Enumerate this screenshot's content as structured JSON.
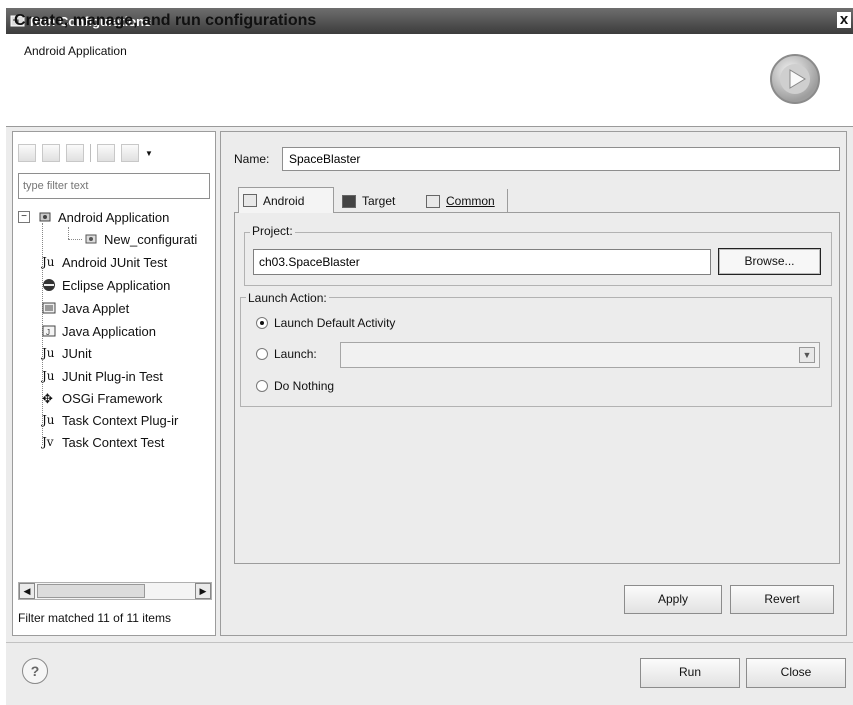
{
  "window": {
    "title": "Run Configurations",
    "close_glyph": "x"
  },
  "header": {
    "title": "Create, manage, and run configurations",
    "subtitle": "Android Application"
  },
  "left": {
    "filter_placeholder": "type filter text",
    "tree": [
      {
        "label": "Android Application",
        "icon": "android-app-icon",
        "expanded": true
      },
      {
        "label": "New_configurati",
        "icon": "android-config-icon"
      },
      {
        "label": "Android JUnit Test",
        "icon": "junit-icon"
      },
      {
        "label": "Eclipse Application",
        "icon": "eclipse-icon"
      },
      {
        "label": "Java Applet",
        "icon": "applet-icon"
      },
      {
        "label": "Java Application",
        "icon": "java-app-icon"
      },
      {
        "label": "JUnit",
        "icon": "junit-icon"
      },
      {
        "label": "JUnit Plug-in Test",
        "icon": "junit-plugin-icon"
      },
      {
        "label": "OSGi Framework",
        "icon": "osgi-icon"
      },
      {
        "label": "Task Context Plug-ir",
        "icon": "task-plugin-icon"
      },
      {
        "label": "Task Context Test",
        "icon": "task-test-icon"
      }
    ],
    "filter_status": "Filter matched 11 of 11 items"
  },
  "right": {
    "name_label": "Name:",
    "name_value": "SpaceBlaster",
    "tabs": [
      {
        "label": "Android",
        "icon": "android-tab-icon",
        "selected": true
      },
      {
        "label": "Target",
        "icon": "target-tab-icon"
      },
      {
        "label": "Common",
        "icon": "common-tab-icon"
      }
    ],
    "project": {
      "group_label": "Project:",
      "value": "ch03.SpaceBlaster",
      "browse_label": "Browse..."
    },
    "launch_action": {
      "group_label": "Launch Action:",
      "options": [
        {
          "label": "Launch Default Activity",
          "checked": true
        },
        {
          "label": "Launch:",
          "checked": false
        },
        {
          "label": "Do Nothing",
          "checked": false
        }
      ],
      "launch_value": ""
    },
    "apply_label": "Apply",
    "revert_label": "Revert"
  },
  "footer": {
    "help_glyph": "?",
    "run_label": "Run",
    "close_label": "Close"
  }
}
